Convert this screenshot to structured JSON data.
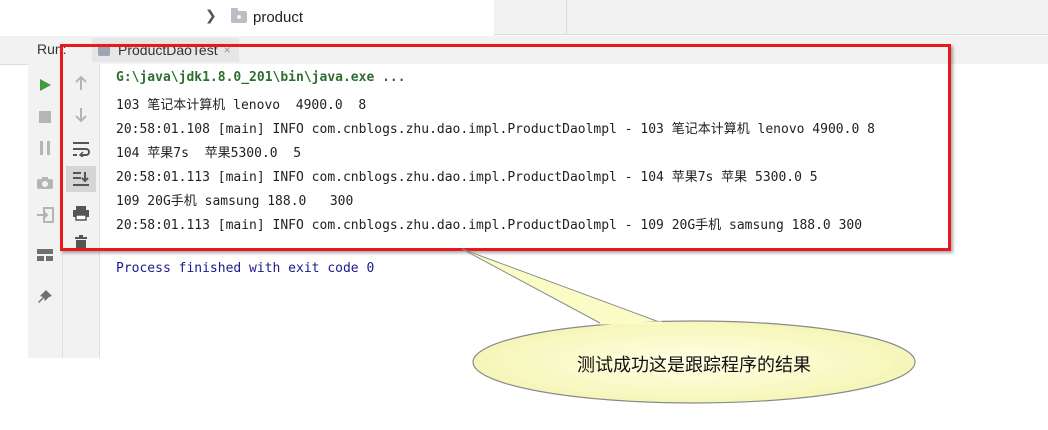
{
  "tree": {
    "folder_label": "product"
  },
  "run_panel": {
    "label": "Run:",
    "tab_label": "ProductDaoTest",
    "tab_close": "×"
  },
  "console": {
    "lines": [
      "G:\\java\\jdk1.8.0_201\\bin\\java.exe ...",
      "103 笔记本计算机 lenovo  4900.0  8",
      "20:58:01.108 [main] INFO com.cnblogs.zhu.dao.impl.ProductDaolmpl - 103 笔记本计算机 lenovo 4900.0 8",
      "104 苹果7s  苹果5300.0  5",
      "20:58:01.113 [main] INFO com.cnblogs.zhu.dao.impl.ProductDaolmpl - 104 苹果7s 苹果 5300.0 5",
      "109 20G手机 samsung 188.0   300",
      "20:58:01.113 [main] INFO com.cnblogs.zhu.dao.impl.ProductDaolmpl - 109 20G手机 samsung 188.0 300"
    ],
    "finish": "Process finished with exit code 0"
  },
  "callout": {
    "text": "测试成功这是跟踪程序的结果"
  },
  "colors": {
    "highlight": "#e8191d",
    "callout_fill": "#fbfbc6",
    "run_green": "#3d9c3d",
    "finish_text": "#1a1a8c"
  },
  "icons": {
    "toolbar1": [
      "run-icon",
      "stop-icon",
      "pause-icon",
      "camera-icon",
      "login-icon",
      "layout-icon",
      "pin-icon"
    ],
    "toolbar2": [
      "up-arrow-icon",
      "down-arrow-icon",
      "soft-wrap-icon",
      "scroll-to-end-icon",
      "print-icon",
      "trash-icon"
    ]
  }
}
